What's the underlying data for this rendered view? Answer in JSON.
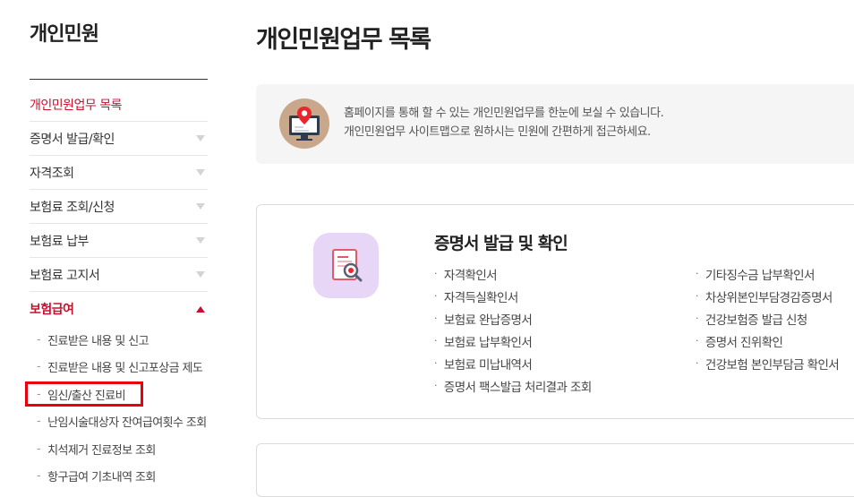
{
  "sidebar": {
    "title": "개인민원",
    "menu": [
      {
        "label": "개인민원업무 목록"
      },
      {
        "label": "증명서 발급/확인"
      },
      {
        "label": "자격조회"
      },
      {
        "label": "보험료 조회/신청"
      },
      {
        "label": "보험료 납부"
      },
      {
        "label": "보험료 고지서"
      },
      {
        "label": "보험급여"
      }
    ],
    "submenu": [
      {
        "label": "진료받은 내용 및 신고"
      },
      {
        "label": "진료받은 내용 및 신고포상금 제도"
      },
      {
        "label": "임신/출산 진료비"
      },
      {
        "label": "난임시술대상자 잔여급여횟수 조회"
      },
      {
        "label": "치석제거 진료정보 조회"
      },
      {
        "label": "항구급여 기초내역 조회"
      }
    ]
  },
  "main": {
    "title": "개인민원업무 목록",
    "info": {
      "line1": "홈페이지를 통해 할 수 있는 개인민원업무를 한눈에 보실 수 있습니다.",
      "line2": "개인민원업무 사이트맵으로 원하시는 민원에 간편하게 접근하세요."
    },
    "card": {
      "title": "증명서 발급 및 확인",
      "col1": [
        "자격확인서",
        "자격득실확인서",
        "보험료 완납증명서",
        "보험료 납부확인서",
        "보험료 미납내역서",
        "증명서 팩스발급 처리결과 조회"
      ],
      "col2": [
        "기타징수금 납부확인서",
        "차상위본인부담경감증명서",
        "건강보험증 발급 신청",
        "증명서 진위확인",
        "건강보험 본인부담금 확인서"
      ]
    }
  },
  "colors": {
    "accent": "#c8102e",
    "highlight": "#e8000b"
  },
  "icons": {
    "info": "monitor-map-pin-icon",
    "card": "document-magnifier-icon"
  }
}
